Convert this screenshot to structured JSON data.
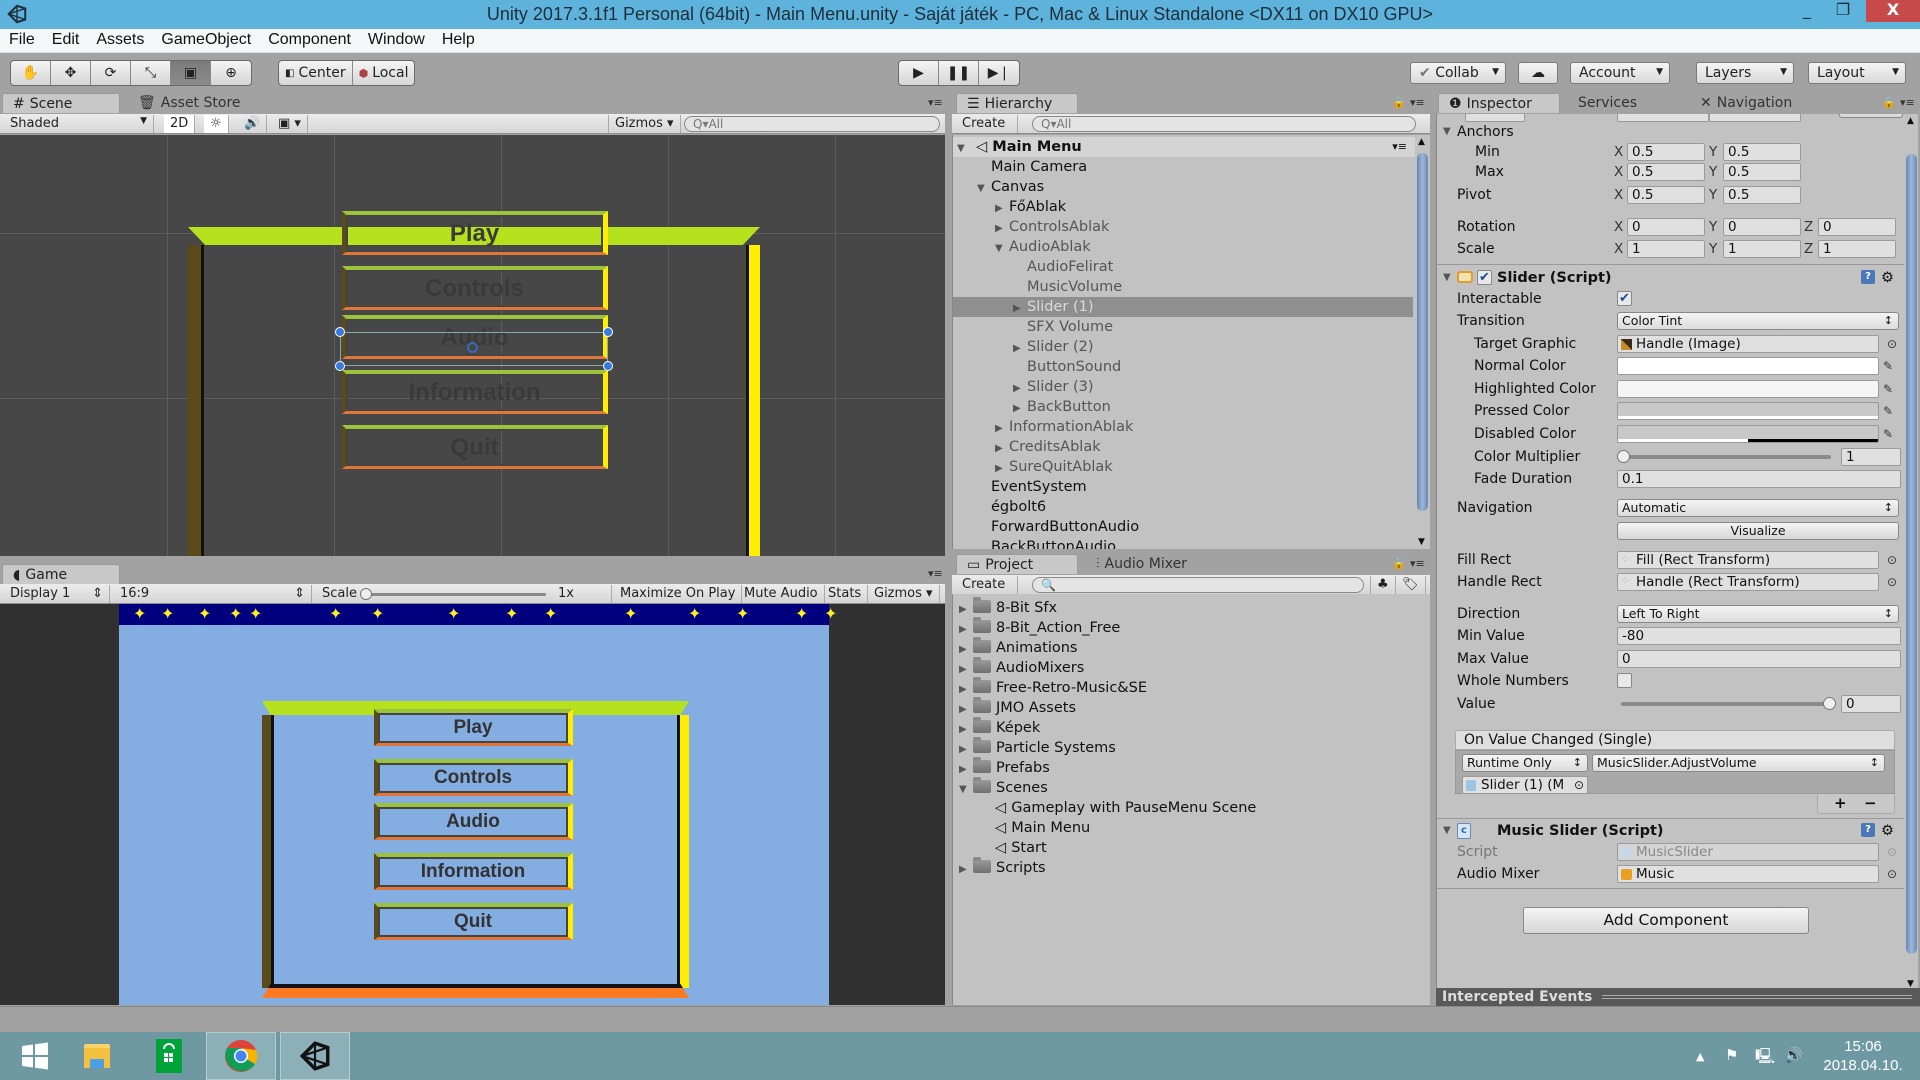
{
  "window": {
    "title": "Unity 2017.3.1f1 Personal (64bit) - Main Menu.unity - Saját játék - PC, Mac & Linux Standalone <DX11 on DX10 GPU>",
    "minimize": "_",
    "maximize": "❐",
    "close": "X"
  },
  "menu": [
    "File",
    "Edit",
    "Assets",
    "GameObject",
    "Component",
    "Window",
    "Help"
  ],
  "toolbar": {
    "tools": [
      "hand-tool",
      "move-tool",
      "rotate-tool",
      "scale-tool",
      "rect-tool",
      "transform-tool"
    ],
    "pivot": "Center",
    "space": "Local",
    "collab": "Collab",
    "account": "Account",
    "layers": "Layers",
    "layout": "Layout"
  },
  "scene": {
    "tabs": [
      "Scene",
      "Asset Store"
    ],
    "shading": "Shaded",
    "mode2d": "2D",
    "gizmos": "Gizmos",
    "search_placeholder": "All",
    "buttons": [
      "Play",
      "Controls",
      "Audio",
      "Information",
      "Quit"
    ]
  },
  "game": {
    "tab": "Game",
    "display": "Display 1",
    "aspect": "16:9",
    "scale_label": "Scale",
    "scale_value": "1x",
    "maximize": "Maximize On Play",
    "mute": "Mute Audio",
    "stats": "Stats",
    "gizmos": "Gizmos",
    "buttons": [
      "Play",
      "Controls",
      "Audio",
      "Information",
      "Quit"
    ],
    "colors": {
      "sky": "#84ade2",
      "stars_bg": "#00007f",
      "star": "#ffee22",
      "frame_top": "#b5e11d",
      "frame_bottom": "#fb7a22",
      "frame_right": "#ffee00"
    }
  },
  "hierarchy": {
    "tab": "Hierarchy",
    "create": "Create",
    "search_placeholder": "All",
    "scene": "Main Menu",
    "items": [
      {
        "label": "Main Camera",
        "depth": 1,
        "arrow": "",
        "style": "normal"
      },
      {
        "label": "Canvas",
        "depth": 1,
        "arrow": "down",
        "style": "normal"
      },
      {
        "label": "FőAblak",
        "depth": 2,
        "arrow": "right",
        "style": "normal"
      },
      {
        "label": "ControlsAblak",
        "depth": 2,
        "arrow": "right",
        "style": "dim"
      },
      {
        "label": "AudioAblak",
        "depth": 2,
        "arrow": "down",
        "style": "dim"
      },
      {
        "label": "AudioFelirat",
        "depth": 3,
        "arrow": "",
        "style": "dim"
      },
      {
        "label": "MusicVolume",
        "depth": 3,
        "arrow": "",
        "style": "dim"
      },
      {
        "label": "Slider (1)",
        "depth": 3,
        "arrow": "right",
        "style": "selected"
      },
      {
        "label": "SFX Volume",
        "depth": 3,
        "arrow": "",
        "style": "dim"
      },
      {
        "label": "Slider (2)",
        "depth": 3,
        "arrow": "right",
        "style": "dim"
      },
      {
        "label": "ButtonSound",
        "depth": 3,
        "arrow": "",
        "style": "dim"
      },
      {
        "label": "Slider (3)",
        "depth": 3,
        "arrow": "right",
        "style": "dim"
      },
      {
        "label": "BackButton",
        "depth": 3,
        "arrow": "right",
        "style": "dim"
      },
      {
        "label": "InformationAblak",
        "depth": 2,
        "arrow": "right",
        "style": "dim"
      },
      {
        "label": "CreditsAblak",
        "depth": 2,
        "arrow": "right",
        "style": "dim"
      },
      {
        "label": "SureQuitAblak",
        "depth": 2,
        "arrow": "right",
        "style": "dim"
      },
      {
        "label": "EventSystem",
        "depth": 1,
        "arrow": "",
        "style": "normal"
      },
      {
        "label": "égbolt6",
        "depth": 1,
        "arrow": "",
        "style": "normal"
      },
      {
        "label": "ForwardButtonAudio",
        "depth": 1,
        "arrow": "",
        "style": "normal"
      },
      {
        "label": "BackButtonAudio",
        "depth": 1,
        "arrow": "",
        "style": "normal"
      }
    ]
  },
  "project": {
    "tabs": [
      "Project",
      "Audio Mixer"
    ],
    "create": "Create",
    "items": [
      {
        "label": "8-Bit Sfx",
        "type": "folder",
        "arrow": "right",
        "depth": 0
      },
      {
        "label": "8-Bit_Action_Free",
        "type": "folder",
        "arrow": "right",
        "depth": 0
      },
      {
        "label": "Animations",
        "type": "folder",
        "arrow": "right",
        "depth": 0
      },
      {
        "label": "AudioMixers",
        "type": "folder",
        "arrow": "right",
        "depth": 0
      },
      {
        "label": "Free-Retro-Music&SE",
        "type": "folder",
        "arrow": "right",
        "depth": 0
      },
      {
        "label": "JMO Assets",
        "type": "folder",
        "arrow": "right",
        "depth": 0
      },
      {
        "label": "Képek",
        "type": "folder",
        "arrow": "right",
        "depth": 0
      },
      {
        "label": "Particle Systems",
        "type": "folder",
        "arrow": "right",
        "depth": 0
      },
      {
        "label": "Prefabs",
        "type": "folder",
        "arrow": "right",
        "depth": 0
      },
      {
        "label": "Scenes",
        "type": "folder",
        "arrow": "down",
        "depth": 0
      },
      {
        "label": "Gameplay with PauseMenu Scene",
        "type": "scene",
        "arrow": "",
        "depth": 1
      },
      {
        "label": "Main Menu",
        "type": "scene",
        "arrow": "",
        "depth": 1
      },
      {
        "label": "Start",
        "type": "scene",
        "arrow": "",
        "depth": 1
      },
      {
        "label": "Scripts",
        "type": "folder",
        "arrow": "right",
        "depth": 0
      }
    ]
  },
  "inspector": {
    "tabs": [
      "Inspector",
      "Services",
      "Navigation"
    ],
    "rect": {
      "anchors": "Anchors",
      "min": {
        "label": "Min",
        "x": "0.5",
        "y": "0.5"
      },
      "max": {
        "label": "Max",
        "x": "0.5",
        "y": "0.5"
      },
      "pivot": {
        "label": "Pivot",
        "x": "0.5",
        "y": "0.5"
      },
      "rotation": {
        "label": "Rotation",
        "x": "0",
        "y": "0",
        "z": "0"
      },
      "scale": {
        "label": "Scale",
        "x": "1",
        "y": "1",
        "z": "1"
      }
    },
    "slider": {
      "title": "Slider (Script)",
      "enabled": true,
      "interactable_label": "Interactable",
      "interactable": true,
      "transition_label": "Transition",
      "transition": "Color Tint",
      "target_graphic_label": "Target Graphic",
      "target_graphic": "Handle (Image)",
      "normal_color_label": "Normal Color",
      "highlighted_color_label": "Highlighted Color",
      "pressed_color_label": "Pressed Color",
      "disabled_color_label": "Disabled Color",
      "colors": {
        "normal": "#ffffff",
        "highlighted": "#f5f5f5",
        "pressed": "#c8c8c8",
        "disabled": "#c8c8c8"
      },
      "color_multiplier_label": "Color Multiplier",
      "color_multiplier": "1",
      "fade_duration_label": "Fade Duration",
      "fade_duration": "0.1",
      "navigation_label": "Navigation",
      "navigation": "Automatic",
      "visualize": "Visualize",
      "fill_rect_label": "Fill Rect",
      "fill_rect": "Fill (Rect Transform)",
      "handle_rect_label": "Handle Rect",
      "handle_rect": "Handle (Rect Transform)",
      "direction_label": "Direction",
      "direction": "Left To Right",
      "min_value_label": "Min Value",
      "min_value": "-80",
      "max_value_label": "Max Value",
      "max_value": "0",
      "whole_numbers_label": "Whole Numbers",
      "whole_numbers": false,
      "value_label": "Value",
      "value": "0",
      "value_fraction": 1.0,
      "event_title": "On Value Changed (Single)",
      "event_mode": "Runtime Only",
      "event_function": "MusicSlider.AdjustVolume",
      "event_target": "Slider (1) (M",
      "plus": "+",
      "minus": "−"
    },
    "music_slider": {
      "title": "Music Slider (Script)",
      "script_label": "Script",
      "script": "MusicSlider",
      "audio_mixer_label": "Audio Mixer",
      "audio_mixer": "Music"
    },
    "add_component": "Add Component",
    "intercepted_events": "Intercepted Events"
  },
  "taskbar": {
    "time": "15:06",
    "date": "2018.04.10."
  }
}
